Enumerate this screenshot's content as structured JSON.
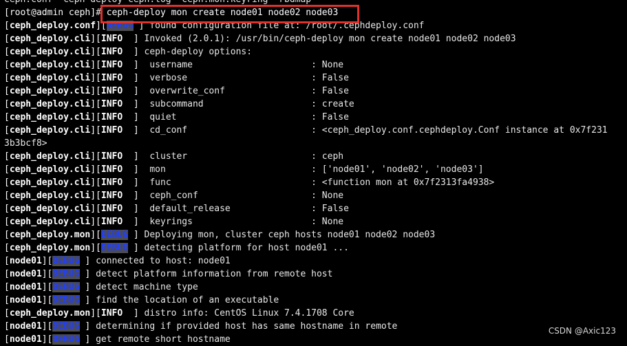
{
  "terminal": {
    "top_line": "ceph.conf  ceph-deploy-ceph.log  ceph.mon.keyring  rbdmap",
    "prompt": "[root@admin ceph]",
    "prompt_sep": "# ",
    "command": "ceph-deploy mon create node01 node02 node03",
    "lines": [
      {
        "prefix": "ceph_deploy.conf",
        "level": "DEBUG",
        "msg": " found configuration file at: /root/.cephdeploy.conf"
      },
      {
        "prefix": "ceph_deploy.cli",
        "level": "INFO ",
        "msg": " Invoked (2.0.1): /usr/bin/ceph-deploy mon create node01 node02 node03"
      },
      {
        "prefix": "ceph_deploy.cli",
        "level": "INFO ",
        "msg": " ceph-deploy options:"
      },
      {
        "prefix": "ceph_deploy.cli",
        "level": "INFO ",
        "msg": "  username                      : None"
      },
      {
        "prefix": "ceph_deploy.cli",
        "level": "INFO ",
        "msg": "  verbose                       : False"
      },
      {
        "prefix": "ceph_deploy.cli",
        "level": "INFO ",
        "msg": "  overwrite_conf                : False"
      },
      {
        "prefix": "ceph_deploy.cli",
        "level": "INFO ",
        "msg": "  subcommand                    : create"
      },
      {
        "prefix": "ceph_deploy.cli",
        "level": "INFO ",
        "msg": "  quiet                         : False"
      },
      {
        "prefix": "ceph_deploy.cli",
        "level": "INFO ",
        "msg": "  cd_conf                       : <ceph_deploy.conf.cephdeploy.Conf instance at 0x7f231"
      },
      {
        "wrap": "3b3bcf8>"
      },
      {
        "prefix": "ceph_deploy.cli",
        "level": "INFO ",
        "msg": "  cluster                       : ceph"
      },
      {
        "prefix": "ceph_deploy.cli",
        "level": "INFO ",
        "msg": "  mon                           : ['node01', 'node02', 'node03']"
      },
      {
        "prefix": "ceph_deploy.cli",
        "level": "INFO ",
        "msg": "  func                          : <function mon at 0x7f2313fa4938>"
      },
      {
        "prefix": "ceph_deploy.cli",
        "level": "INFO ",
        "msg": "  ceph_conf                     : None"
      },
      {
        "prefix": "ceph_deploy.cli",
        "level": "INFO ",
        "msg": "  default_release               : False"
      },
      {
        "prefix": "ceph_deploy.cli",
        "level": "INFO ",
        "msg": "  keyrings                      : None"
      },
      {
        "prefix": "ceph_deploy.mon",
        "level": "DEBUG",
        "msg": " Deploying mon, cluster ceph hosts node01 node02 node03"
      },
      {
        "prefix": "ceph_deploy.mon",
        "level": "DEBUG",
        "msg": " detecting platform for host node01 ..."
      },
      {
        "prefix": "node01",
        "level": "DEBUG",
        "msg": " connected to host: node01"
      },
      {
        "prefix": "node01",
        "level": "DEBUG",
        "msg": " detect platform information from remote host"
      },
      {
        "prefix": "node01",
        "level": "DEBUG",
        "msg": " detect machine type"
      },
      {
        "prefix": "node01",
        "level": "DEBUG",
        "msg": " find the location of an executable"
      },
      {
        "prefix": "ceph_deploy.mon",
        "level": "INFO ",
        "msg": " distro info: CentOS Linux 7.4.1708 Core"
      },
      {
        "prefix": "node01",
        "level": "DEBUG",
        "msg": " determining if provided host has same hostname in remote"
      },
      {
        "prefix": "node01",
        "level": "DEBUG",
        "msg": " get remote short hostname"
      }
    ],
    "highlight_color": "#e0322c",
    "debug_color": "#1f3cff"
  },
  "watermark": "CSDN @Axic123"
}
